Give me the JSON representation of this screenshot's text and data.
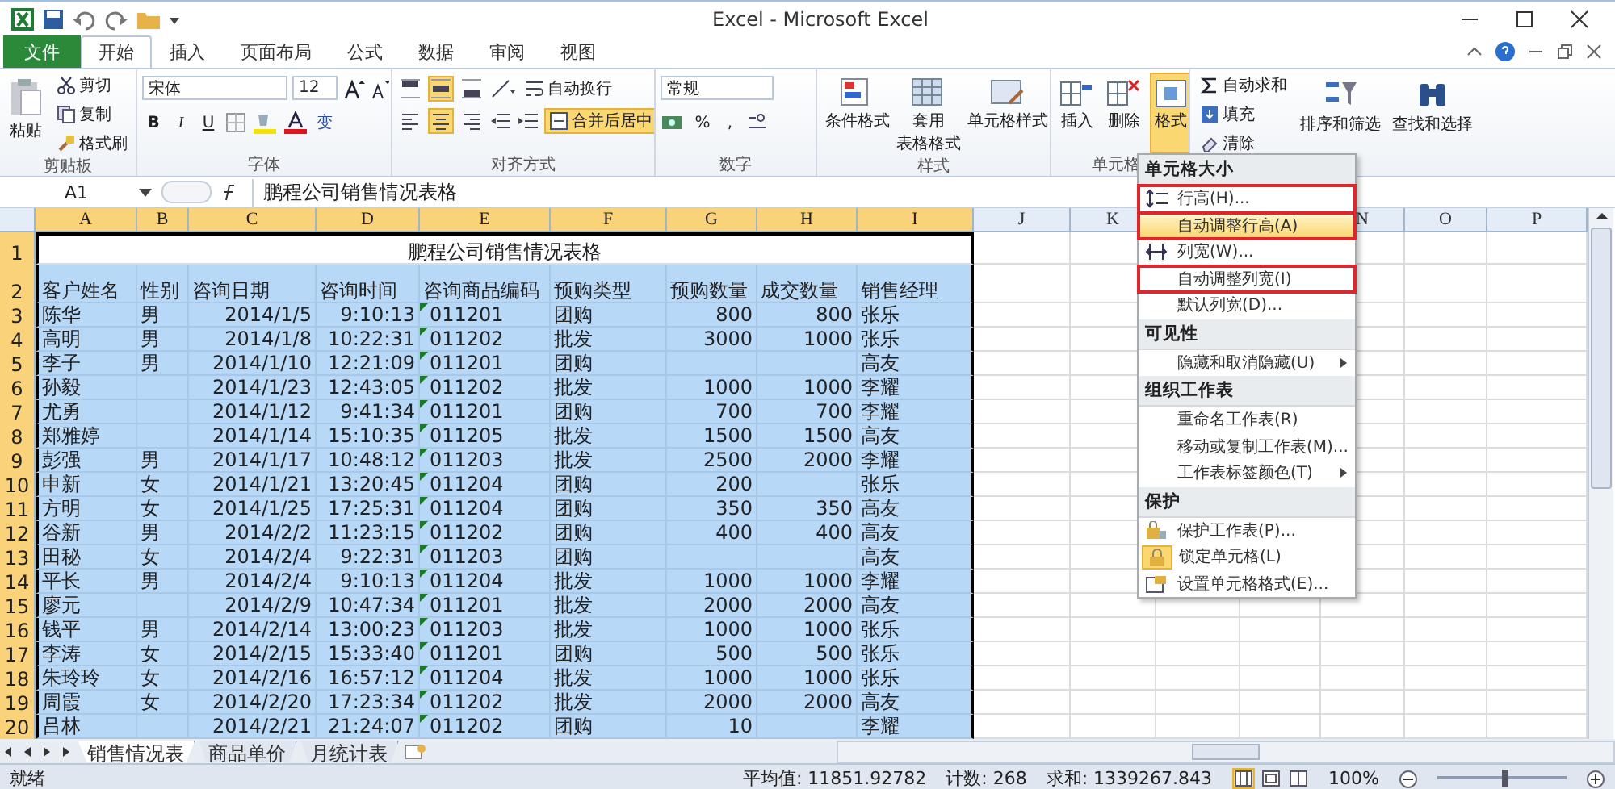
{
  "window": {
    "title": "Excel - Microsoft Excel"
  },
  "tabs": [
    {
      "label": "文件",
      "kind": "file",
      "selected": false
    },
    {
      "label": "开始",
      "kind": "tab",
      "selected": true
    },
    {
      "label": "插入",
      "kind": "tab",
      "selected": false
    },
    {
      "label": "页面布局",
      "kind": "tab",
      "selected": false
    },
    {
      "label": "公式",
      "kind": "tab",
      "selected": false
    },
    {
      "label": "数据",
      "kind": "tab",
      "selected": false
    },
    {
      "label": "审阅",
      "kind": "tab",
      "selected": false
    },
    {
      "label": "视图",
      "kind": "tab",
      "selected": false
    }
  ],
  "ribbon": {
    "clipboard": {
      "label": "剪贴板",
      "paste": "粘贴",
      "items": [
        "剪切",
        "复制",
        "格式刷"
      ]
    },
    "font": {
      "label": "字体",
      "family": "宋体",
      "size": "12",
      "bold": "B",
      "italic": "I",
      "underline": "U",
      "phonetic": "变"
    },
    "alignment": {
      "label": "对齐方式",
      "vertical": [
        {
          "selected": false
        },
        {
          "selected": true
        },
        {
          "selected": false
        }
      ],
      "horizontal": [
        {
          "selected": false
        },
        {
          "selected": true
        },
        {
          "selected": false
        }
      ],
      "wrap": "自动换行",
      "merge": {
        "label": "合并后居中",
        "selected": true
      }
    },
    "number": {
      "label": "数字",
      "format": "常规",
      "percent": "%",
      "comma": ","
    },
    "styles": {
      "label": "样式",
      "items": [
        {
          "lines": [
            "条件格式"
          ]
        },
        {
          "lines": [
            "套用",
            "表格格式"
          ]
        },
        {
          "lines": [
            "单元格样式"
          ]
        }
      ]
    },
    "cells": {
      "label": "单元格",
      "items": [
        {
          "label": "插入",
          "selected": false
        },
        {
          "label": "删除",
          "selected": false
        },
        {
          "label": "格式",
          "selected": true
        }
      ]
    },
    "editing": {
      "small": [
        "自动求和",
        "填充",
        "清除"
      ],
      "large": [
        "排序和筛选",
        "查找和选择"
      ]
    }
  },
  "formula_bar": {
    "name_box": "A1",
    "content": "鹏程公司销售情况表格"
  },
  "sheet": {
    "columns": [
      {
        "label": "A",
        "selected": true
      },
      {
        "label": "B",
        "selected": true
      },
      {
        "label": "C",
        "selected": true
      },
      {
        "label": "D",
        "selected": true
      },
      {
        "label": "E",
        "selected": true
      },
      {
        "label": "F",
        "selected": true
      },
      {
        "label": "G",
        "selected": true
      },
      {
        "label": "H",
        "selected": true
      },
      {
        "label": "I",
        "selected": true
      },
      {
        "label": "J",
        "selected": false
      },
      {
        "label": "K",
        "selected": false
      },
      {
        "label": "N",
        "selected": false
      },
      {
        "label": "O",
        "selected": false
      },
      {
        "label": "P",
        "selected": false
      }
    ],
    "rows": [
      {
        "number": "1",
        "kind": "title",
        "selected": true,
        "flag": false,
        "merged_title": "鹏程公司销售情况表格"
      },
      {
        "number": "2",
        "kind": "header",
        "selected": true,
        "flag": false,
        "cells": [
          "客户姓名",
          "性别",
          "咨询日期",
          "咨询时间",
          "咨询商品编码",
          "预购类型",
          "预购数量",
          "成交数量",
          "销售经理"
        ]
      },
      {
        "number": "3",
        "kind": "data",
        "selected": true,
        "flag": true,
        "cells": [
          "陈华",
          "男",
          "2014/1/5",
          "9:10:13",
          "011201",
          "团购",
          "800",
          "800",
          "张乐"
        ]
      },
      {
        "number": "4",
        "kind": "data",
        "selected": true,
        "flag": true,
        "cells": [
          "高明",
          "男",
          "2014/1/8",
          "10:22:31",
          "011202",
          "批发",
          "3000",
          "1000",
          "张乐"
        ]
      },
      {
        "number": "5",
        "kind": "data",
        "selected": true,
        "flag": true,
        "cells": [
          "李子",
          "男",
          "2014/1/10",
          "12:21:09",
          "011201",
          "团购",
          null,
          null,
          "高友"
        ]
      },
      {
        "number": "6",
        "kind": "data",
        "selected": true,
        "flag": true,
        "cells": [
          "孙毅",
          null,
          "2014/1/23",
          "12:43:05",
          "011202",
          "批发",
          "1000",
          "1000",
          "李耀"
        ]
      },
      {
        "number": "7",
        "kind": "data",
        "selected": true,
        "flag": true,
        "cells": [
          "尤勇",
          null,
          "2014/1/12",
          "9:41:34",
          "011201",
          "团购",
          "700",
          "700",
          "李耀"
        ]
      },
      {
        "number": "8",
        "kind": "data",
        "selected": true,
        "flag": true,
        "cells": [
          "郑雅婷",
          null,
          "2014/1/14",
          "15:10:35",
          "011205",
          "批发",
          "1500",
          "1500",
          "高友"
        ]
      },
      {
        "number": "9",
        "kind": "data",
        "selected": true,
        "flag": true,
        "cells": [
          "彭强",
          "男",
          "2014/1/17",
          "10:48:12",
          "011203",
          "批发",
          "2500",
          "2000",
          "李耀"
        ]
      },
      {
        "number": "10",
        "kind": "data",
        "selected": true,
        "flag": true,
        "cells": [
          "申新",
          "女",
          "2014/1/21",
          "13:20:45",
          "011204",
          "团购",
          "200",
          null,
          "张乐"
        ]
      },
      {
        "number": "11",
        "kind": "data",
        "selected": true,
        "flag": true,
        "cells": [
          "方明",
          "女",
          "2014/1/25",
          "17:25:31",
          "011204",
          "团购",
          "350",
          "350",
          "高友"
        ]
      },
      {
        "number": "12",
        "kind": "data",
        "selected": true,
        "flag": true,
        "cells": [
          "谷新",
          "男",
          "2014/2/2",
          "11:23:15",
          "011202",
          "团购",
          "400",
          "400",
          "高友"
        ]
      },
      {
        "number": "13",
        "kind": "data",
        "selected": true,
        "flag": true,
        "cells": [
          "田秘",
          "女",
          "2014/2/4",
          "9:22:31",
          "011203",
          "团购",
          null,
          null,
          "高友"
        ]
      },
      {
        "number": "14",
        "kind": "data",
        "selected": true,
        "flag": true,
        "cells": [
          "平长",
          "男",
          "2014/2/4",
          "9:10:13",
          "011204",
          "批发",
          "1000",
          "1000",
          "李耀"
        ]
      },
      {
        "number": "15",
        "kind": "data",
        "selected": true,
        "flag": true,
        "cells": [
          "廖元",
          null,
          "2014/2/9",
          "10:47:34",
          "011201",
          "批发",
          "2000",
          "2000",
          "高友"
        ]
      },
      {
        "number": "16",
        "kind": "data",
        "selected": true,
        "flag": true,
        "cells": [
          "钱平",
          "男",
          "2014/2/14",
          "13:00:23",
          "011203",
          "批发",
          "1000",
          "1000",
          "张乐"
        ]
      },
      {
        "number": "17",
        "kind": "data",
        "selected": true,
        "flag": true,
        "cells": [
          "李涛",
          "女",
          "2014/2/15",
          "15:33:40",
          "011201",
          "团购",
          "500",
          "500",
          "张乐"
        ]
      },
      {
        "number": "18",
        "kind": "data",
        "selected": true,
        "flag": true,
        "cells": [
          "朱玲玲",
          "女",
          "2014/2/16",
          "16:57:12",
          "011204",
          "批发",
          "1000",
          "1000",
          "张乐"
        ]
      },
      {
        "number": "19",
        "kind": "data",
        "selected": true,
        "flag": true,
        "cells": [
          "周霞",
          "女",
          "2014/2/20",
          "17:23:34",
          "011202",
          "批发",
          "2000",
          "2000",
          "高友"
        ]
      },
      {
        "number": "20",
        "kind": "data",
        "selected": true,
        "flag": true,
        "cells": [
          "吕林",
          null,
          "2014/2/21",
          "21:24:07",
          "011202",
          "团购",
          "10",
          null,
          "李耀"
        ]
      }
    ]
  },
  "menu": {
    "sections": [
      {
        "heading": "单元格大小",
        "items": [
          {
            "label": "行高(H)...",
            "kind": "rowheight",
            "selected": false,
            "checked": false,
            "boxed": true
          },
          {
            "label": "自动调整行高(A)",
            "kind": "plain",
            "selected": true,
            "checked": false,
            "boxed": true
          },
          {
            "label": "列宽(W)...",
            "kind": "colwidth",
            "selected": false,
            "checked": false,
            "boxed": false
          },
          {
            "label": "自动调整列宽(I)",
            "kind": "plain",
            "selected": false,
            "checked": false,
            "boxed": true
          },
          {
            "label": "默认列宽(D)...",
            "kind": "plain",
            "selected": false,
            "checked": false,
            "boxed": false
          }
        ]
      },
      {
        "heading": "可见性",
        "items": [
          {
            "label": "隐藏和取消隐藏(U)",
            "kind": "submenu",
            "selected": false,
            "checked": false,
            "boxed": false
          }
        ]
      },
      {
        "heading": "组织工作表",
        "items": [
          {
            "label": "重命名工作表(R)",
            "kind": "plain",
            "selected": false,
            "checked": false,
            "boxed": false
          },
          {
            "label": "移动或复制工作表(M)...",
            "kind": "plain",
            "selected": false,
            "checked": false,
            "boxed": false
          },
          {
            "label": "工作表标签颜色(T)",
            "kind": "submenu",
            "selected": false,
            "checked": false,
            "boxed": false
          }
        ]
      },
      {
        "heading": "保护",
        "items": [
          {
            "label": "保护工作表(P)...",
            "kind": "protect",
            "selected": false,
            "checked": false,
            "boxed": false
          },
          {
            "label": "锁定单元格(L)",
            "kind": "lock",
            "selected": false,
            "checked": true,
            "boxed": false
          },
          {
            "label": "设置单元格格式(E)...",
            "kind": "format",
            "selected": false,
            "checked": false,
            "boxed": false
          }
        ]
      }
    ]
  },
  "sheet_tabs": [
    {
      "label": "销售情况表",
      "selected": true
    },
    {
      "label": "商品单价",
      "selected": false
    },
    {
      "label": "月统计表",
      "selected": false
    }
  ],
  "status_bar": {
    "ready": "就绪",
    "stats": [
      "平均值: 11851.92782",
      "计数: 268",
      "求和: 1339267.843"
    ],
    "views": [
      {
        "selected": true
      },
      {
        "selected": false
      },
      {
        "selected": false
      }
    ],
    "zoom": {
      "label": "100%",
      "level": 0.5
    }
  }
}
